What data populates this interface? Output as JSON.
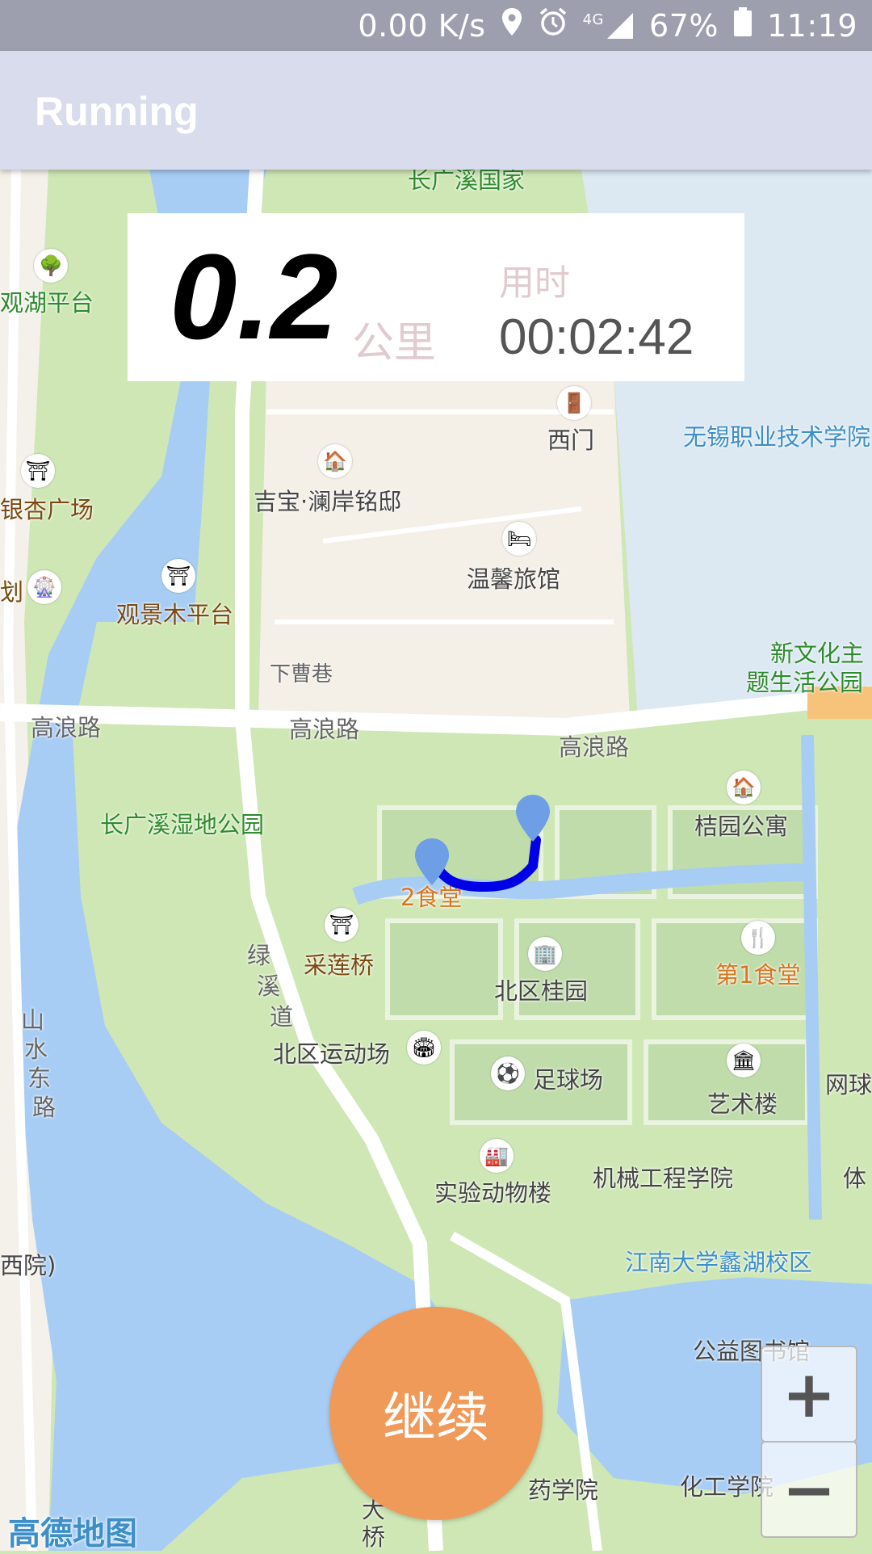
{
  "status_bar": {
    "net_speed": "0.00 K/s",
    "network": "4G",
    "battery": "67%",
    "time": "11:19",
    "icons": [
      "location-icon",
      "alarm-icon",
      "signal-icon",
      "battery-icon"
    ]
  },
  "app_bar": {
    "title": "Running"
  },
  "stats": {
    "distance": "0.2",
    "distance_unit": "公里",
    "time_label": "用时",
    "elapsed_time": "00:02:42"
  },
  "map": {
    "labels": {
      "top_park": "长广溪国家",
      "guanhu": "观湖平台",
      "yinxing": "银杏广场",
      "hua": "划",
      "guanjingmu": "观景木平台",
      "ximen": "西门",
      "jibao": "吉宝·澜岸铭邸",
      "wenxin": "温馨旅馆",
      "xiacao": "下曹巷",
      "wuxi_college": "无锡职业技术学院",
      "xinwenhua_1": "新文化主",
      "xinwenhua_2": "题生活公园",
      "gaolang_1": "高浪路",
      "gaolang_2": "高浪路",
      "gaolang_3": "高浪路",
      "changguangxi_wetland": "长广溪湿地公园",
      "juyuan": "桔园公寓",
      "canteen2": "2食堂",
      "canteen1": "第1食堂",
      "cailian": "采莲桥",
      "beiqu_guiyuan": "北区桂园",
      "luxidao_1": "绿",
      "luxidao_2": "溪",
      "luxidao_3": "道",
      "shanshui_1": "山",
      "shanshui_2": "水",
      "shanshui_3": "东",
      "shanshui_4": "路",
      "beiqu_sports": "北区运动场",
      "football": "足球场",
      "art": "艺术楼",
      "wangqiu": "网球",
      "ti": "体",
      "animal": "实验动物楼",
      "mech": "机械工程学院",
      "jiangnan": "江南大学蠡湖校区",
      "library": "公益图书馆",
      "pharmacy": "药学院",
      "chemistry": "化工学院",
      "bridge_1": "大",
      "bridge_2": "桥",
      "hospital": "西院)"
    },
    "logo": "高德地图"
  },
  "controls": {
    "continue_label": "继续",
    "zoom_in": "+",
    "zoom_out": "−"
  }
}
